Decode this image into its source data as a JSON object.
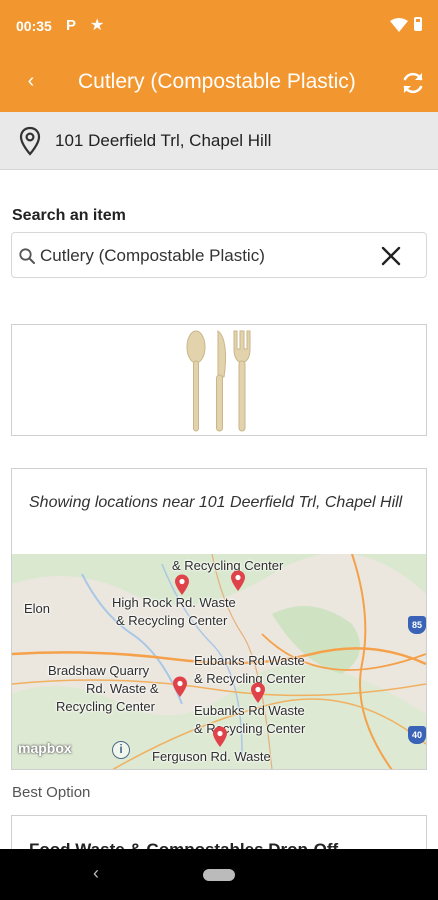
{
  "status": {
    "time": "00:35",
    "notif_p": "P",
    "notif_star": "★",
    "wifi_icon": "wifi-icon",
    "battery_icon": "battery-icon"
  },
  "app_bar": {
    "title": "Cutlery (Compostable Plastic)",
    "back_glyph": "‹",
    "back_icon": "back-chevron-icon",
    "refresh_icon": "refresh-icon",
    "color": "#f2962f"
  },
  "location": {
    "address": "101 Deerfield Trl, Chapel Hill",
    "icon": "location-pin-icon"
  },
  "search": {
    "label": "Search an item",
    "value": "Cutlery (Compostable Plastic)",
    "placeholder": "",
    "clear_icon": "close-icon",
    "search_icon": "search-icon"
  },
  "item": {
    "image": "cutlery-icon"
  },
  "map": {
    "caption": "Showing locations near 101 Deerfield Trl, Chapel Hill",
    "labels": {
      "top_center": "& Recycling Center",
      "elon": "Elon",
      "high_rock_1": "High Rock Rd. Waste",
      "high_rock_2": "& Recycling Center",
      "bradshaw_1": "Bradshaw Quarry",
      "bradshaw_2": "Rd. Waste &",
      "bradshaw_3": "Recycling Center",
      "eubanks_a1": "Eubanks Rd Waste",
      "eubanks_a2": "& Recycling Center",
      "eubanks_b1": "Eubanks Rd Waste",
      "eubanks_b2": "& Recycling Center",
      "ferguson": "Ferguson Rd. Waste",
      "shield_85": "85",
      "shield_40": "40"
    },
    "attribution": "mapbox",
    "info_glyph": "i",
    "marker_color": "#e0424a"
  },
  "best_option": {
    "label": "Best Option",
    "title": "Food Waste & Compostables Drop-Off"
  },
  "nav": {
    "back_glyph": "‹"
  }
}
